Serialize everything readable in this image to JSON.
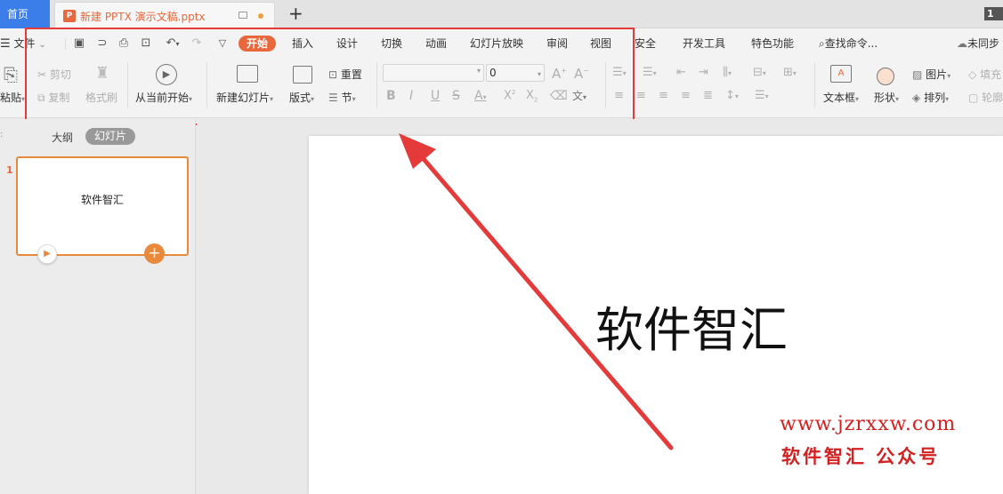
{
  "tabs": {
    "home": "首页",
    "document": "新建 PPTX 演示文稿.pptx",
    "page_badge": "1"
  },
  "menu": {
    "file": "文件",
    "items": [
      "开始",
      "插入",
      "设计",
      "切换",
      "动画",
      "幻灯片放映",
      "审阅",
      "视图",
      "安全",
      "开发工具",
      "特色功能"
    ],
    "search": "查找命令...",
    "sync": "未同步"
  },
  "ribbon": {
    "paste": "粘贴",
    "cut": "剪切",
    "copy": "复制",
    "format_painter": "格式刷",
    "from_current": "从当前开始",
    "new_slide": "新建幻灯片",
    "layout": "版式",
    "reset": "重置",
    "section": "节",
    "font_size": "0",
    "font_name": "",
    "textbox": "文本框",
    "shape": "形状",
    "picture": "图片",
    "arrange": "排列",
    "fill": "填充",
    "outline": "轮廓"
  },
  "panel": {
    "outline_tab": "大纲",
    "slides_tab": "幻灯片",
    "slide_number": "1",
    "thumb_title": "软件智汇"
  },
  "slide": {
    "title": "软件智汇"
  },
  "watermark": {
    "url": "www.jzrxxw.com",
    "brand": "软件智汇 公众号"
  },
  "colors": {
    "accent": "#e8673c",
    "home_tab": "#3c7ee9",
    "annotation": "#e53a3a"
  }
}
